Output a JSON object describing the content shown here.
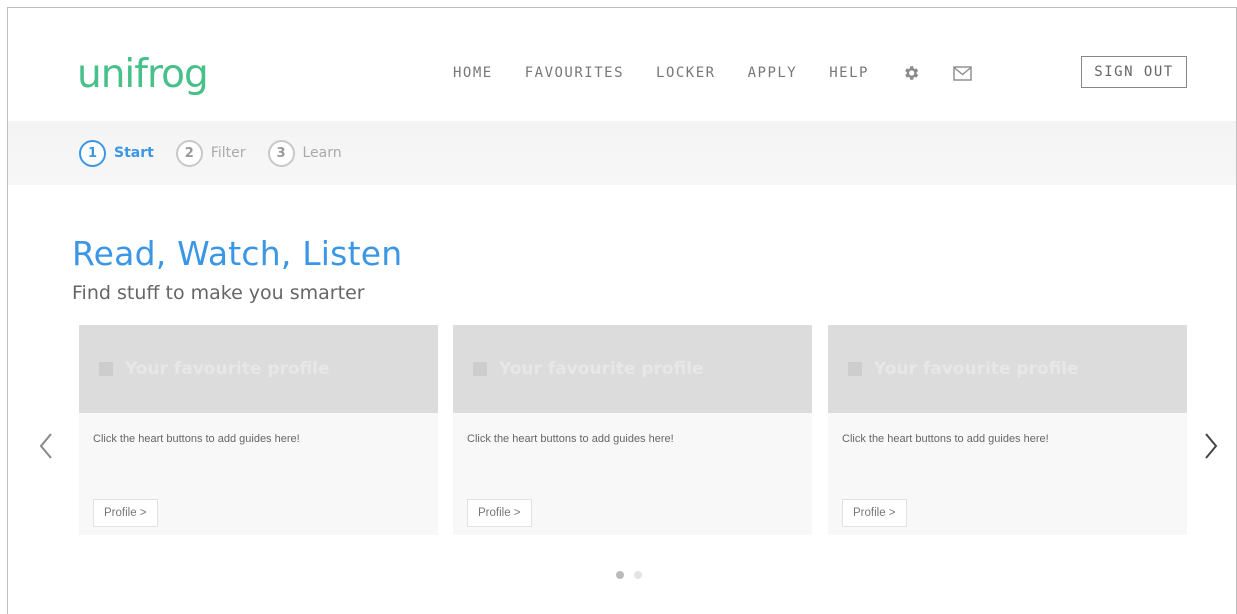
{
  "header": {
    "logo": "unifrog",
    "nav": [
      "HOME",
      "FAVOURITES",
      "LOCKER",
      "APPLY",
      "HELP"
    ],
    "icons": [
      "gear-icon",
      "mail-icon"
    ],
    "sign_out": "SIGN OUT"
  },
  "steps": [
    {
      "num": "1",
      "label": "Start",
      "active": true
    },
    {
      "num": "2",
      "label": "Filter",
      "active": false
    },
    {
      "num": "3",
      "label": "Learn",
      "active": false
    }
  ],
  "hero": {
    "title": "Read, Watch, Listen",
    "subtitle": "Find stuff to make you smarter"
  },
  "cards": [
    {
      "heading": "Your favourite profile",
      "text": "Click the heart buttons to add guides here!",
      "button": "Profile >"
    },
    {
      "heading": "Your favourite profile",
      "text": "Click the heart buttons to add guides here!",
      "button": "Profile >"
    },
    {
      "heading": "Your favourite profile",
      "text": "Click the heart buttons to add guides here!",
      "button": "Profile >"
    }
  ],
  "carousel": {
    "prev_icon": "chevron-left-icon",
    "next_icon": "chevron-right-icon",
    "dots": 2,
    "active_dot": 0
  },
  "colors": {
    "brand": "#48c08a",
    "accent": "#3b97e6",
    "card_header": "#dcdcdc",
    "steps_bg": "#f4f4f4"
  }
}
